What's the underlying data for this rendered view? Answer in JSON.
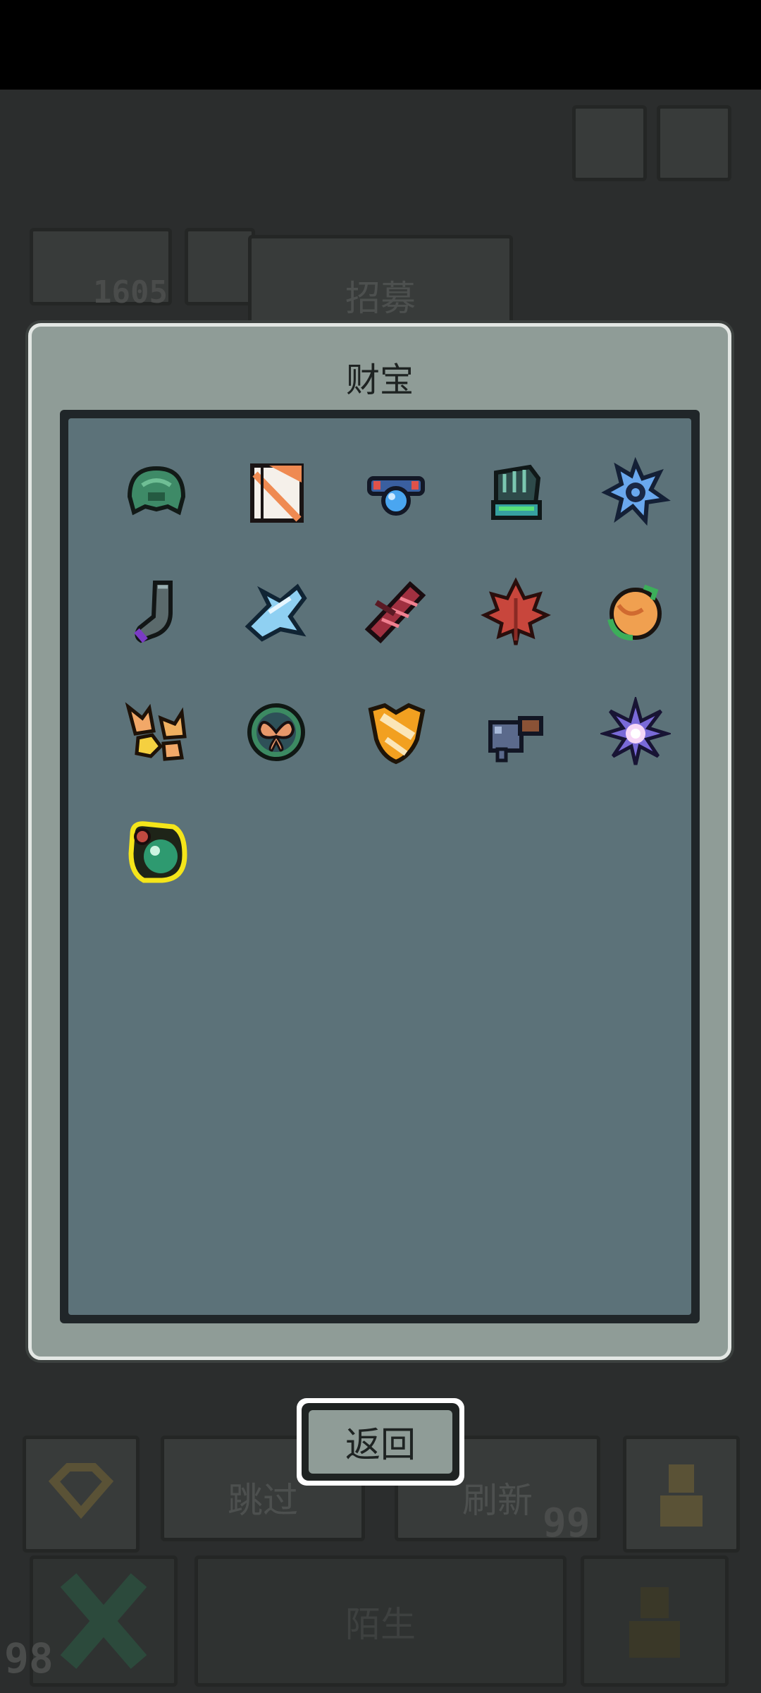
{
  "background": {
    "top_counter": "1605",
    "recruit_label": "招募",
    "skip_label": "跳过",
    "refresh_label": "刷新",
    "refresh_count": "99",
    "bottom_left_count": "98",
    "bottom_center_label": "陌生"
  },
  "dialog": {
    "title": "财宝",
    "items": [
      {
        "icon": "green-helmet-icon"
      },
      {
        "icon": "striped-banner-icon"
      },
      {
        "icon": "blue-orb-goggles-icon"
      },
      {
        "icon": "teal-gauntlet-icon"
      },
      {
        "icon": "blue-gear-flower-icon"
      },
      {
        "icon": "gray-sock-icon"
      },
      {
        "icon": "ice-wing-icon"
      },
      {
        "icon": "red-dna-helix-icon"
      },
      {
        "icon": "red-maple-leaf-icon"
      },
      {
        "icon": "orange-fruit-icon"
      },
      {
        "icon": "fox-figures-icon"
      },
      {
        "icon": "butterfly-medallion-icon"
      },
      {
        "icon": "orange-shield-icon"
      },
      {
        "icon": "toy-cannon-icon"
      },
      {
        "icon": "purple-starflower-icon"
      },
      {
        "icon": "green-potion-flask-icon"
      }
    ]
  },
  "back_button": {
    "label": "返回"
  },
  "colors": {
    "dialog_bg": "#8f9c97",
    "panel_bg": "#5c7279",
    "highlight": "#f5e51a"
  }
}
